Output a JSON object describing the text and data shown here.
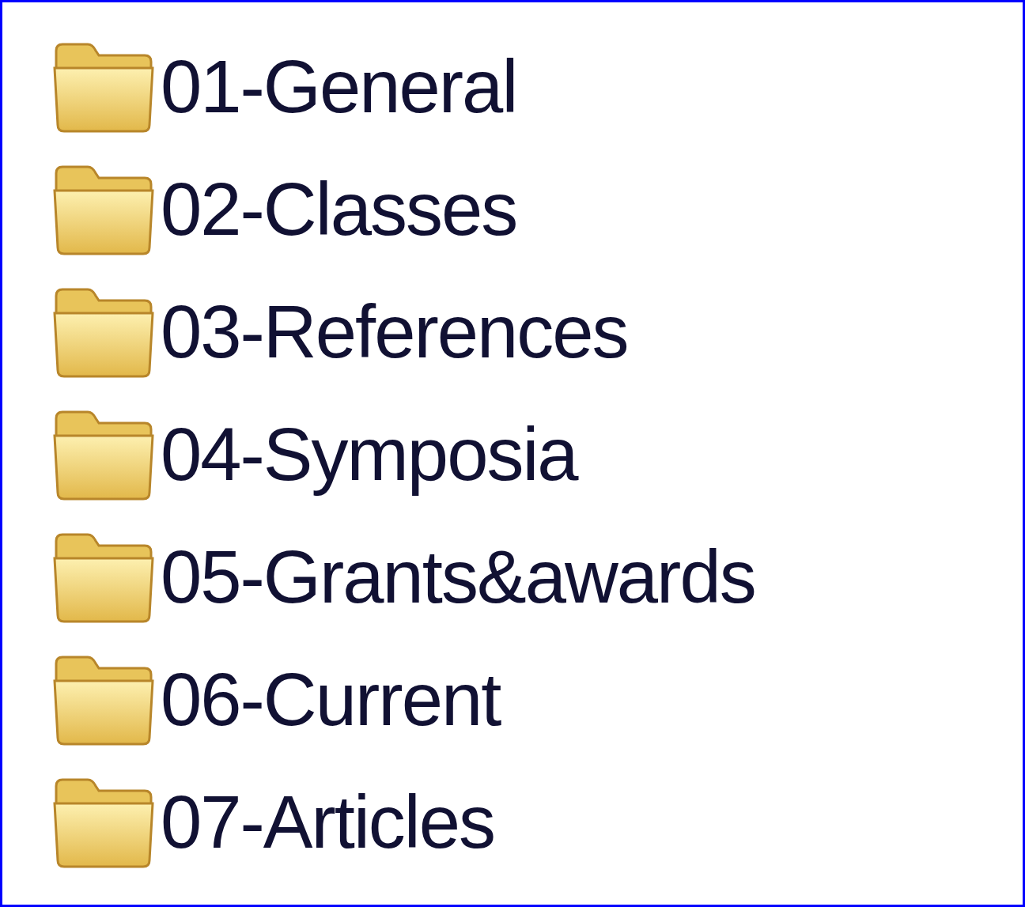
{
  "folders": [
    {
      "name": "01-General"
    },
    {
      "name": "02-Classes"
    },
    {
      "name": "03-References"
    },
    {
      "name": "04-Symposia"
    },
    {
      "name": "05-Grants&awards"
    },
    {
      "name": "06-Current"
    },
    {
      "name": "07-Articles"
    }
  ]
}
